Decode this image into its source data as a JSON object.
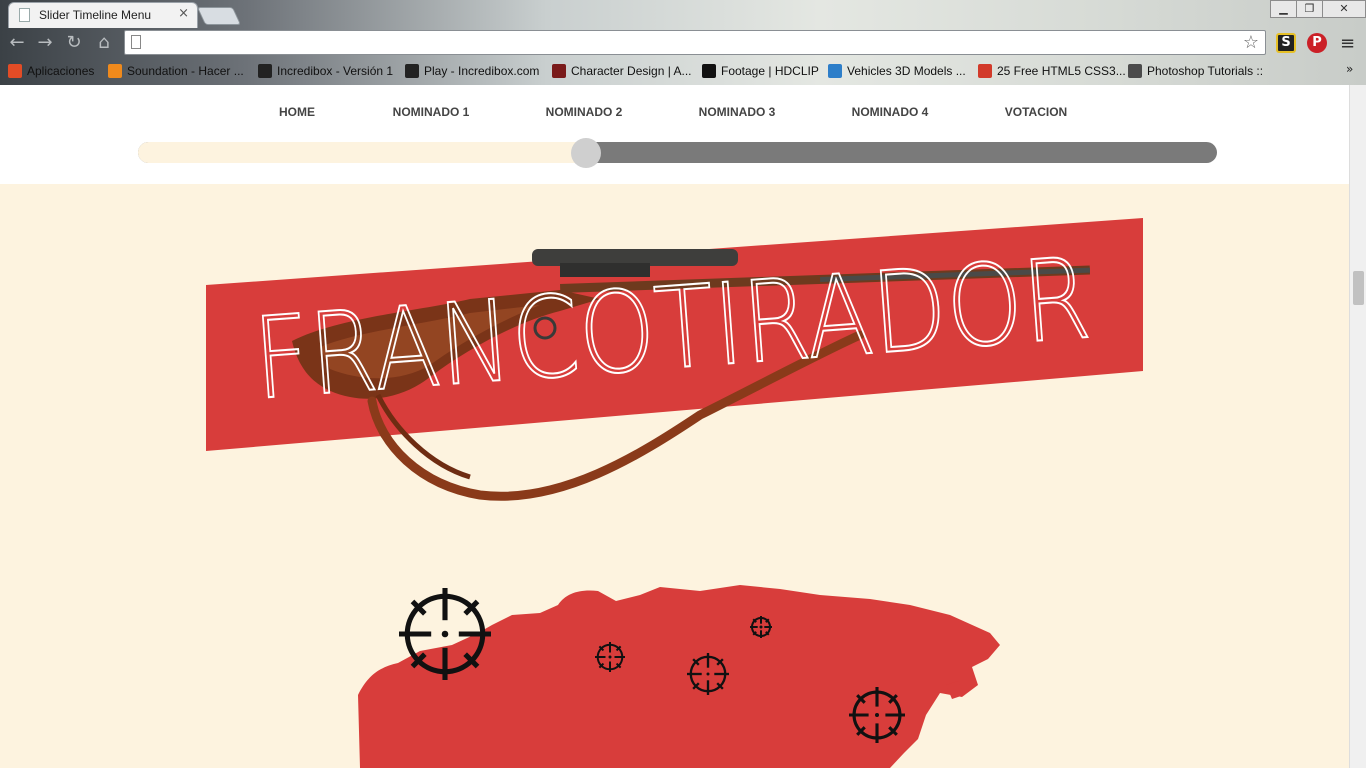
{
  "browser": {
    "tab_title": "Slider Timeline Menu",
    "tab_close": "×",
    "window_buttons": {
      "minimize": "▁",
      "maximize": "❐",
      "close": "✕"
    },
    "nav": {
      "back": "←",
      "forward": "→",
      "reload": "↻",
      "home": "⌂"
    },
    "address": "",
    "star": "☆",
    "extensions": [
      {
        "name": "S",
        "color": "#222222"
      },
      {
        "name": "P",
        "color": "#cb2027"
      }
    ],
    "menu": "≡",
    "bookmarks": [
      {
        "label": "Aplicaciones",
        "icon": "apps-grid-icon",
        "color": "#e34c26"
      },
      {
        "label": "Soundation - Hacer ...",
        "icon": "soundation-icon",
        "color": "#f08a1c"
      },
      {
        "label": "Incredibox - Versión 1",
        "icon": "cube-icon",
        "color": "#222222"
      },
      {
        "label": "Play - Incredibox.com",
        "icon": "cube-icon",
        "color": "#222222"
      },
      {
        "label": "Character Design | A...",
        "icon": "cd-icon",
        "color": "#7a1a1a"
      },
      {
        "label": "Footage | HDCLIP",
        "icon": "footage-icon",
        "color": "#111111"
      },
      {
        "label": "Vehicles 3D Models ...",
        "icon": "3d-icon",
        "color": "#2d7ec9"
      },
      {
        "label": "25 Free HTML5 CSS3...",
        "icon": "html5-icon",
        "color": "#d23a2a"
      },
      {
        "label": "Photoshop Tutorials ::",
        "icon": "photoshop-icon",
        "color": "#4b4b4b"
      }
    ],
    "bookmarks_more": "»"
  },
  "nav": {
    "items": [
      "HOME",
      "NOMINADO 1",
      "NOMINADO 2",
      "NOMINADO 3",
      "NOMINADO 4",
      "VOTACION"
    ],
    "active_index": 2
  },
  "slider": {
    "progress": 0.415
  },
  "banner": {
    "title": "FRANCOTIRADOR"
  },
  "colors": {
    "page_bg": "#fdf3df",
    "accent_red": "#d83d3b",
    "track": "#7a7a7a",
    "knob": "#cfcfcf",
    "nav_text": "#444444"
  }
}
